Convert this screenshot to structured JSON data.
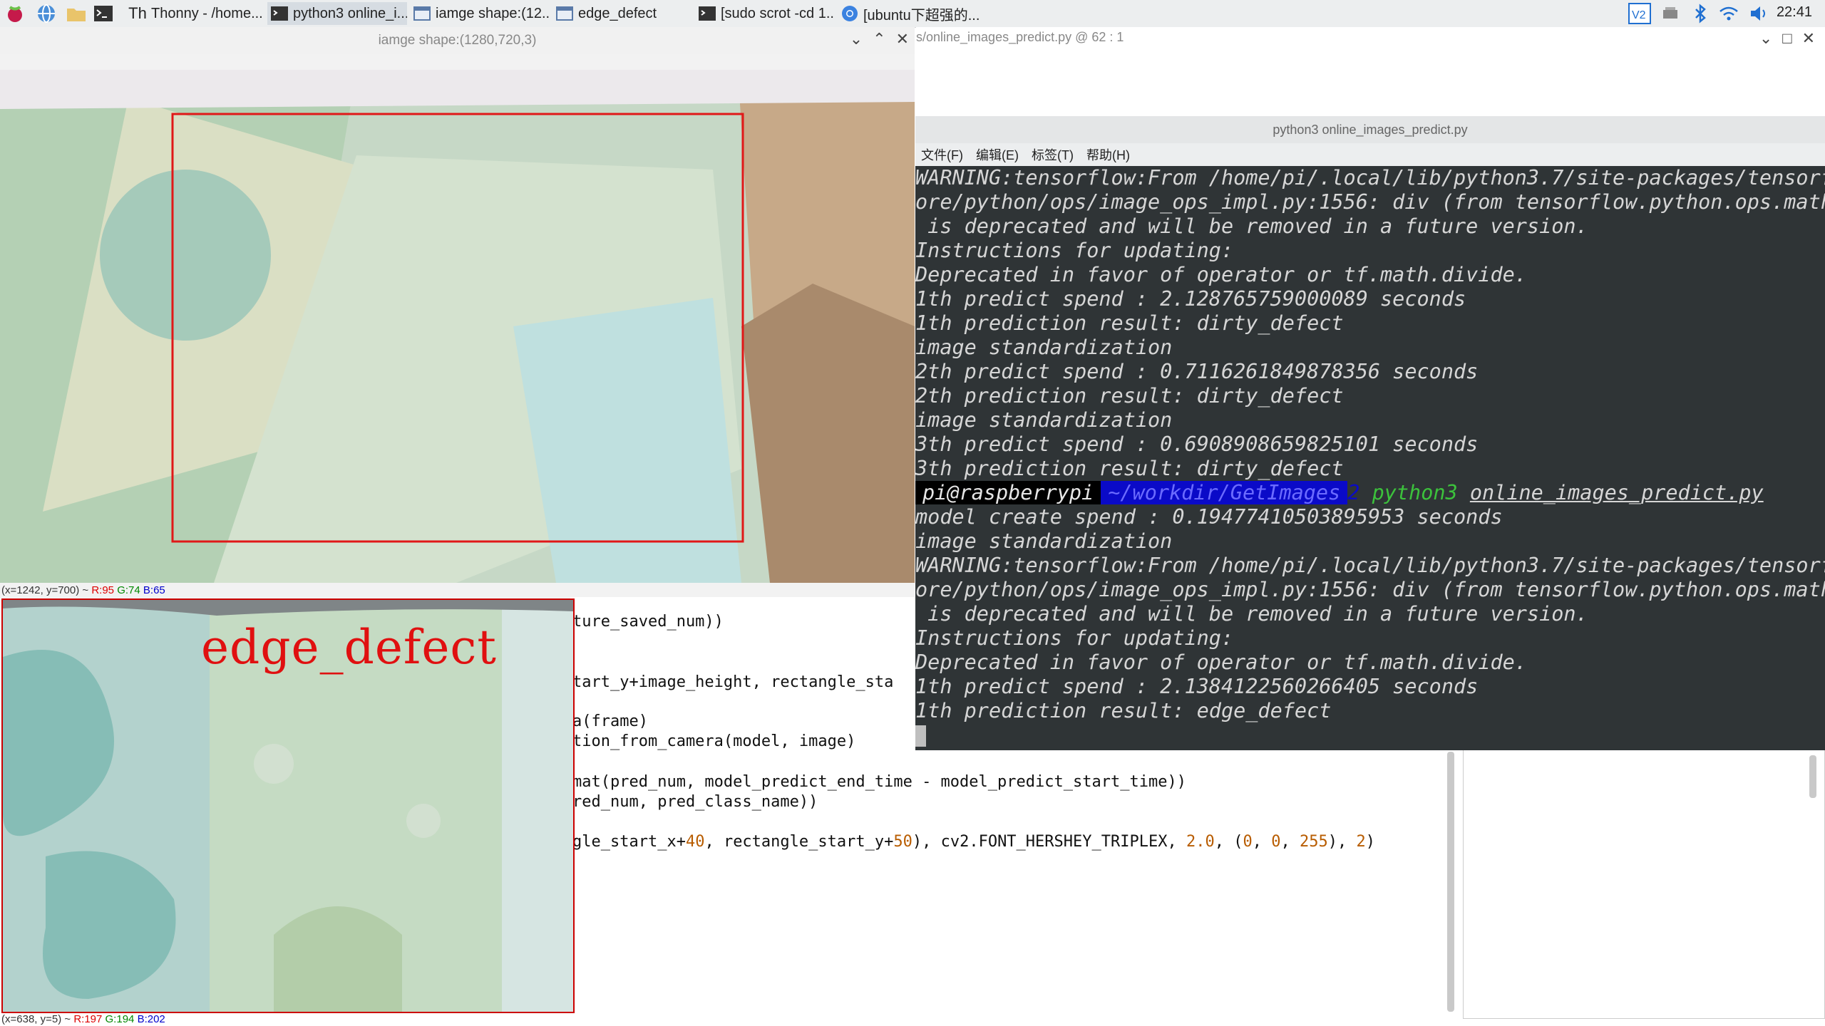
{
  "taskbar": {
    "apps": [
      {
        "label": "Thonny  -  /home...",
        "icon": "thonny-icon"
      },
      {
        "label": "python3 online_i...",
        "icon": "terminal-icon"
      },
      {
        "label": "iamge shape:(12...",
        "icon": "window-icon"
      },
      {
        "label": "edge_defect",
        "icon": "window-icon"
      },
      {
        "label": "[sudo scrot -cd 1...",
        "icon": "terminal-icon"
      },
      {
        "label": "[ubuntu下超强的...",
        "icon": "chromium-icon"
      }
    ],
    "clock": "22:41"
  },
  "image_window": {
    "title": "iamge shape:(1280,720,3)",
    "status": "(x=1242, y=700) ~ R:95 G:74 B:65",
    "status_parts": {
      "coords": "(x=1242, y=700) ~ ",
      "r": "R:95",
      "g": "G:74",
      "b": "B:65"
    }
  },
  "edge_window": {
    "label": "edge_defect",
    "status_parts": {
      "coords": "(x=638, y=5) ~ ",
      "r": "R:197",
      "g": "G:194",
      "b": "B:202"
    }
  },
  "thonny": {
    "path": "s/online_images_predict.py  @  62 : 1"
  },
  "editor_lines": [
    {
      "text": "ture_saved_num))"
    },
    {
      "text": "tart_y+image_height, rectangle_sta"
    },
    {
      "text": "a(frame)"
    },
    {
      "text": "tion_from_camera(model, image)"
    },
    {
      "text": "mat(pred_num, model_predict_end_time - model_predict_start_time))"
    },
    {
      "text": "red_num, pred_class_name))"
    }
  ],
  "editor_last": {
    "a": "gle_start_x+",
    "n1": "40",
    "b": ", rectangle_start_y+",
    "n2": "50",
    "c": "), cv2.FONT_HERSHEY_TRIPLEX, ",
    "n3": "2.0",
    "d": ", (",
    "n4": "0",
    "e": ", ",
    "n5": "0",
    "f": ", ",
    "n6": "255",
    "g": "), ",
    "n7": "2",
    "h": ")"
  },
  "terminal": {
    "title": "python3 online_images_predict.py",
    "menu": [
      "文件(F)",
      "编辑(E)",
      "标签(T)",
      "帮助(H)"
    ],
    "lines": [
      "WARNING:tensorflow:From /home/pi/.local/lib/python3.7/site-packages/tensorf",
      "ore/python/ops/image_ops_impl.py:1556: div (from tensorflow.python.ops.math",
      " is deprecated and will be removed in a future version.",
      "Instructions for updating:",
      "Deprecated in favor of operator or tf.math.divide.",
      "1th predict spend : 2.128765759000089 seconds",
      "1th prediction result: dirty_defect",
      "image standardization",
      "2th predict spend : 0.7116261849878356 seconds",
      "2th prediction result: dirty_defect",
      "image standardization",
      "3th predict spend : 0.6908908659825101 seconds",
      "3th prediction result: dirty_defect"
    ],
    "prompt": {
      "user": "pi@raspberrypi",
      "path": "~/workdir/GetImages",
      "sep": "2",
      "cmd": "python3",
      "arg": "online_images_predict.py"
    },
    "lines2": [
      "model create spend : 0.19477410503895953 seconds",
      "image standardization",
      "WARNING:tensorflow:From /home/pi/.local/lib/python3.7/site-packages/tensorf",
      "ore/python/ops/image_ops_impl.py:1556: div (from tensorflow.python.ops.math",
      " is deprecated and will be removed in a future version.",
      "Instructions for updating:",
      "Deprecated in favor of operator or tf.math.divide.",
      "1th predict spend : 2.1384122560266405 seconds",
      "1th prediction result: edge_defect"
    ]
  }
}
